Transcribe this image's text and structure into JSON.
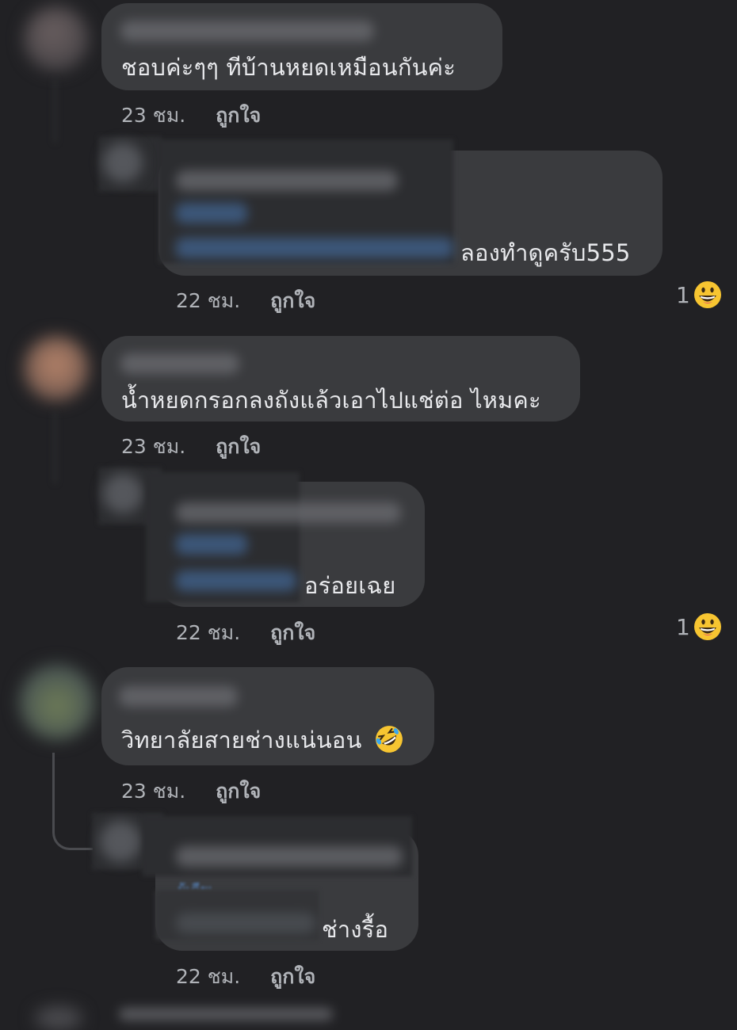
{
  "comments": [
    {
      "text": "ชอบค่ะๆๆ  ทีบ้านหยดเหมือนกันค่ะ",
      "time": "23 ชม.",
      "like_label": "ถูกใจ",
      "reply": {
        "text": "ลองทำดูครับ555",
        "time": "22 ชม.",
        "like_label": "ถูกใจ",
        "reaction_count": "1",
        "reaction_icon": "grinning-face-icon"
      }
    },
    {
      "text": "น้ำหยดกรอกลงถังแล้วเอาไปแช่ต่อ ไหมคะ",
      "time": "23 ชม.",
      "like_label": "ถูกใจ",
      "reply": {
        "text": "อร่อยเฉย",
        "time": "22 ชม.",
        "like_label": "ถูกใจ",
        "reaction_count": "1",
        "reaction_icon": "grinning-face-icon"
      }
    },
    {
      "text": "วิทยาลัยสายช่างแน่นอน",
      "emoji": "rolling-on-floor-laughing-icon",
      "time": "23 ชม.",
      "like_label": "ถูกใจ",
      "reply": {
        "mention_peek": "ผู้เดียเ",
        "text": "ช่างรื้อ",
        "time": "22 ชม.",
        "like_label": "ถูกใจ"
      }
    }
  ],
  "colors": {
    "background": "#212124",
    "bubble": "#3a3b3e",
    "meta_text": "#b0b3b8",
    "mention_link": "#5c93d8"
  }
}
